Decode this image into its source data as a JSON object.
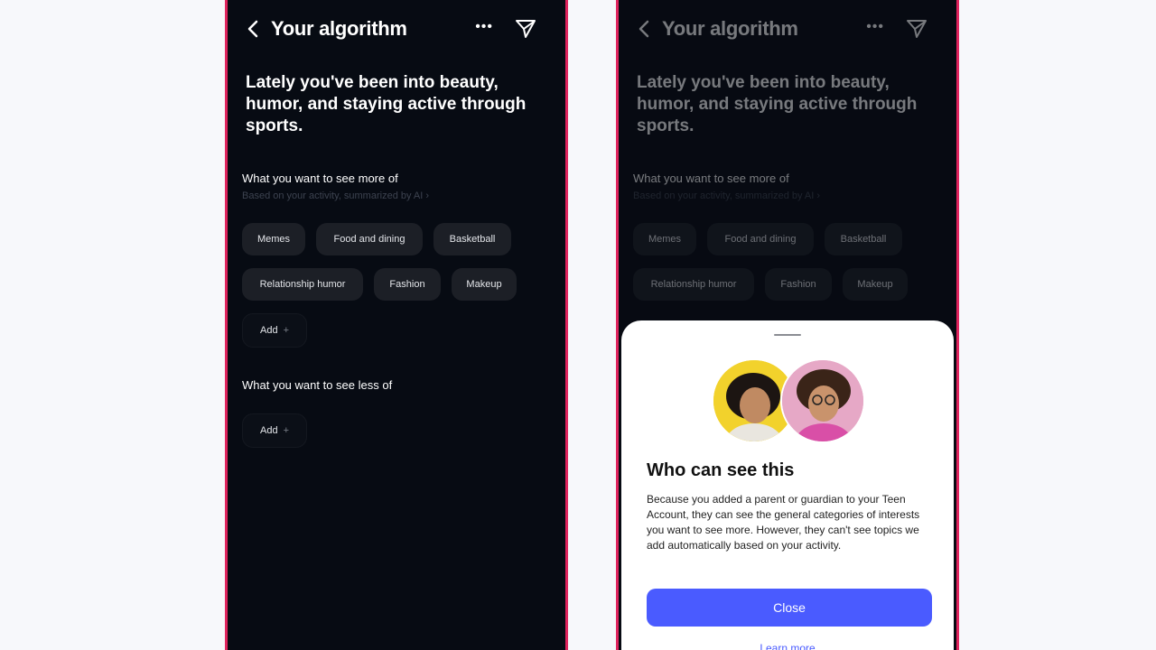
{
  "colors": {
    "page_background": "#f7f8fb",
    "phone_background": "#070b13",
    "phone_border": "#e0245e",
    "chip_background": "#1c1f26",
    "primary_button": "#4a5bff",
    "sheet_background": "#ffffff"
  },
  "header": {
    "back_icon": "chevron-left-icon",
    "title": "Your algorithm",
    "more_icon": "more-horizontal-icon",
    "more_glyph": "•••",
    "send_icon": "send-icon"
  },
  "headline": "Lately you've been into beauty, humor, and staying active through sports.",
  "more_section": {
    "title": "What you want to see more of",
    "subtitle": "Based on your activity, summarized by AI",
    "subtitle_chevron": "›",
    "chips": [
      "Memes",
      "Food and dining",
      "Basketball",
      "Relationship humor",
      "Fashion",
      "Makeup"
    ],
    "add_label": "Add",
    "add_icon": "+"
  },
  "less_section": {
    "title": "What you want to see less of",
    "add_label": "Add",
    "add_icon": "+"
  },
  "sheet": {
    "title": "Who can see this",
    "body": "Because you added a parent or guardian to your Teen Account, they can see the general categories of interests you want to see more. However, they can't see topics we add automatically based on your activity.",
    "close_label": "Close",
    "learn_more_label": "Learn more"
  }
}
